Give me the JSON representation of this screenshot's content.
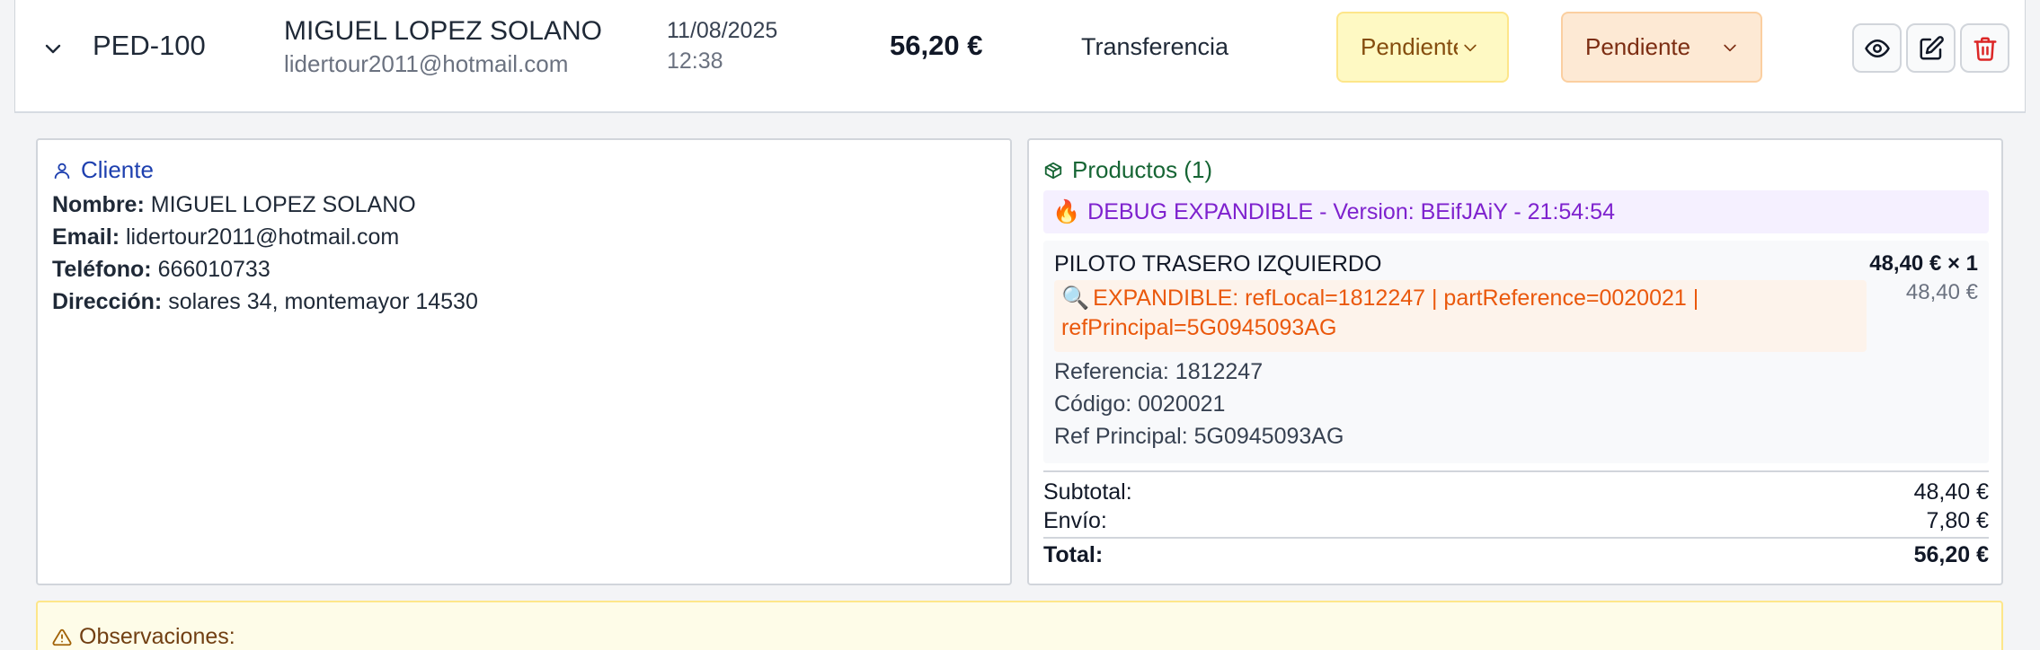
{
  "order": {
    "id": "PED-100",
    "customer_name": "MIGUEL LOPEZ SOLANO",
    "customer_email": "lidertour2011@hotmail.com",
    "date": "11/08/2025",
    "time": "12:38",
    "amount": "56,20 €",
    "payment_method": "Transferencia",
    "payment_status": "Pendiente",
    "order_status": "Pendiente"
  },
  "client": {
    "title": "Cliente",
    "name_label": "Nombre:",
    "name": "MIGUEL LOPEZ SOLANO",
    "email_label": "Email:",
    "email": "lidertour2011@hotmail.com",
    "phone_label": "Teléfono:",
    "phone": "666010733",
    "address_label": "Dirección:",
    "address": "solares 34, montemayor 14530"
  },
  "products": {
    "title": "Productos (1)",
    "debug_banner": "DEBUG EXPANDIBLE - Version: BEifJAiY - 21:54:54",
    "items": [
      {
        "name": "PILOTO TRASERO IZQUIERDO",
        "price_qty": "48,40 € × 1",
        "line_total": "48,40 €",
        "debug": "EXPANDIBLE: refLocal=1812247 | partReference=0020021 | refPrincipal=5G0945093AG",
        "reference": "Referencia: 1812247",
        "code": "Código: 0020021",
        "main_ref": "Ref Principal: 5G0945093AG"
      }
    ],
    "subtotal_label": "Subtotal:",
    "subtotal": "48,40 €",
    "shipping_label": "Envío:",
    "shipping": "7,80 €",
    "total_label": "Total:",
    "total": "56,20 €"
  },
  "observations": {
    "title": "Observaciones:"
  },
  "colors": {
    "client_accent": "#1e40af",
    "products_accent": "#166534",
    "debug_purple": "#7e22ce",
    "debug_orange": "#ea580c",
    "delete_red": "#dc2626"
  },
  "icons": [
    "chevron-down-icon",
    "eye-icon",
    "edit-icon",
    "trash-icon",
    "user-icon",
    "package-icon",
    "fire-icon",
    "magnifier-icon",
    "warning-icon"
  ]
}
